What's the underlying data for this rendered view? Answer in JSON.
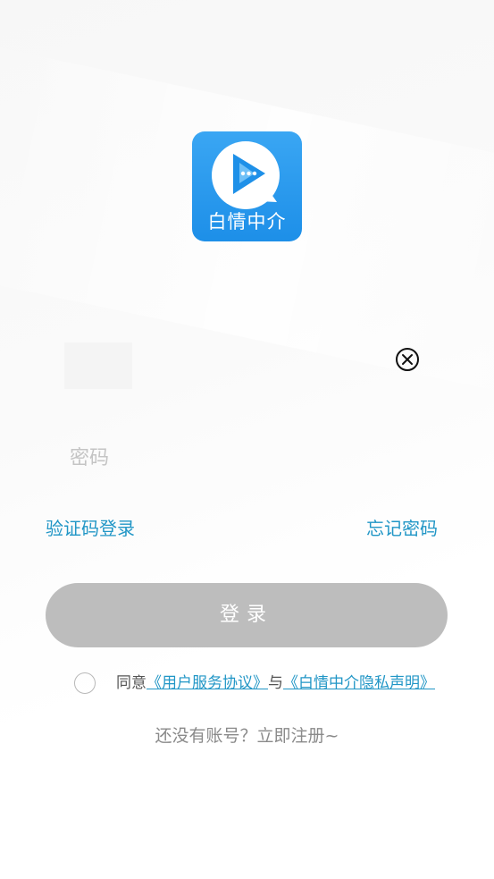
{
  "app": {
    "logo_text": "白情中介",
    "brand_color": "#2196f3"
  },
  "form": {
    "account_value": "",
    "password_placeholder": "密码",
    "clear_icon": "close-circle-icon"
  },
  "links": {
    "sms_login": "验证码登录",
    "forgot_password": "忘记密码"
  },
  "login_button": {
    "label": "登录",
    "color": "#bdbdbd"
  },
  "agreement": {
    "checked": false,
    "prefix": "同意",
    "user_agreement": "《用户服务协议》",
    "conjunction": "与",
    "privacy_policy": "《白情中介隐私声明》"
  },
  "register": {
    "text": "还没有账号？立即注册~"
  },
  "colors": {
    "link": "#2196c6",
    "muted_text": "#8a8a8a"
  }
}
